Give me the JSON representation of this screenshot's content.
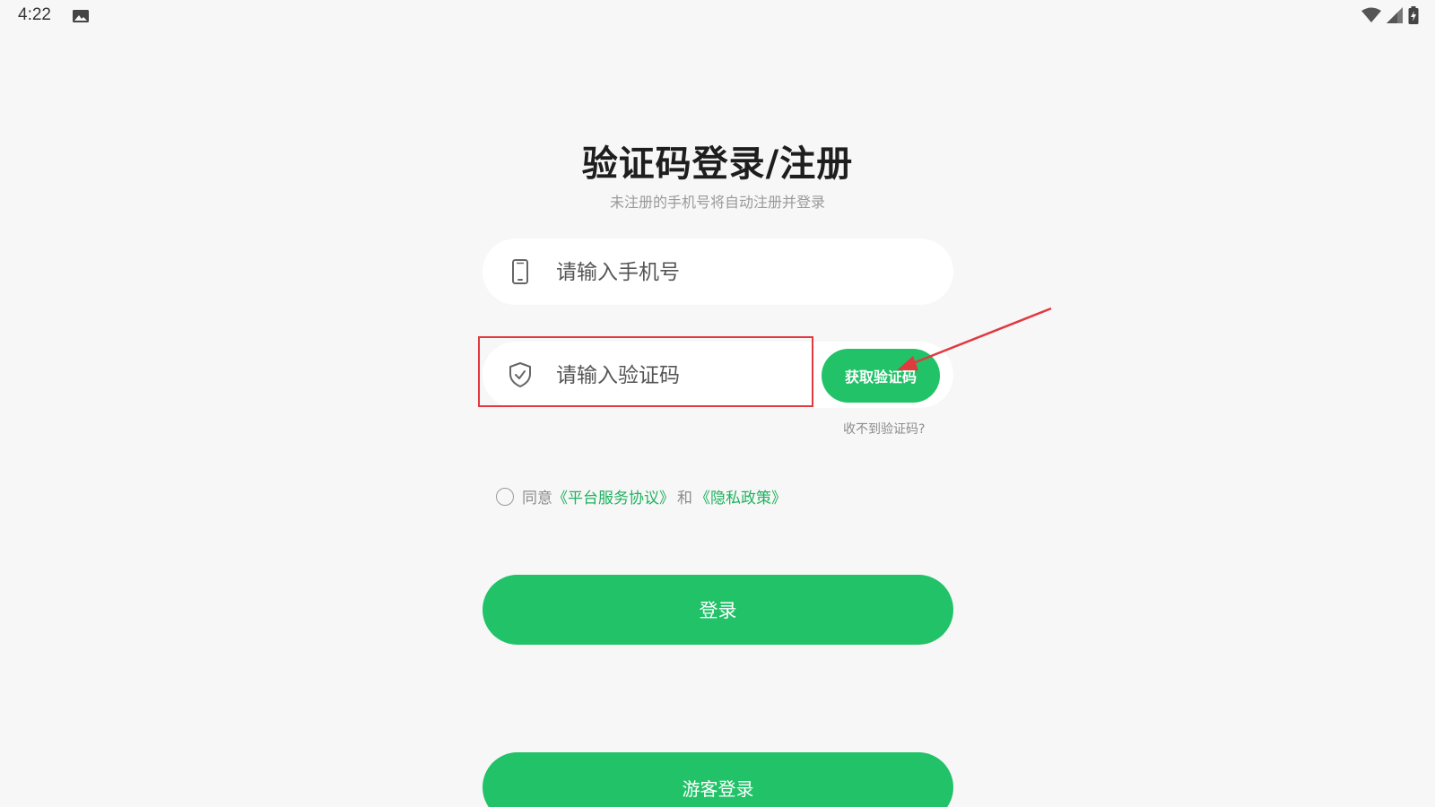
{
  "status_bar": {
    "time": "4:22",
    "left_icons": [
      "image-icon"
    ],
    "right_icons": [
      "wifi-icon",
      "signal-icon",
      "battery-icon"
    ]
  },
  "page": {
    "title": "验证码登录/注册",
    "subtitle": "未注册的手机号将自动注册并登录"
  },
  "phone_field": {
    "icon": "phone-icon",
    "placeholder": "请输入手机号",
    "value": ""
  },
  "code_field": {
    "icon": "shield-check-icon",
    "placeholder": "请输入验证码",
    "value": ""
  },
  "get_code_button": {
    "label": "获取验证码"
  },
  "no_code_link": "收不到验证码?",
  "agreement": {
    "checked": false,
    "prefix": "同意",
    "service_link": "《平台服务协议》",
    "and": "和",
    "privacy_link": "《隐私政策》"
  },
  "login_button": {
    "label": "登录"
  },
  "guest_button": {
    "label": "游客登录"
  },
  "colors": {
    "accent": "#21c268",
    "link": "#1fb25d",
    "annotation": "#e0393e",
    "background": "#f7f7f7"
  }
}
